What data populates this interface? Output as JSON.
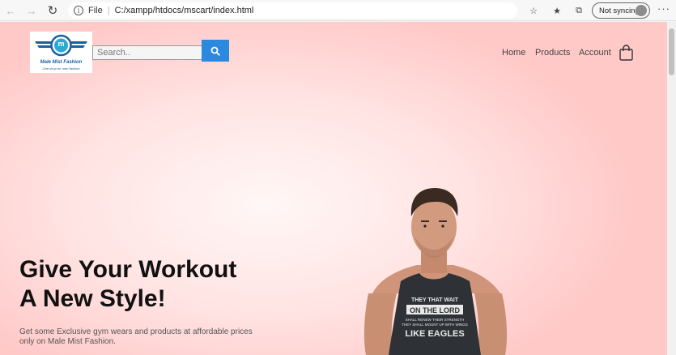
{
  "browser": {
    "file_label": "File",
    "url": "C:/xampp/htdocs/mscart/index.html",
    "sync_label": "Not syncing"
  },
  "site": {
    "brand": "Male Mist Fashion",
    "tagline": "One shop for men fashion",
    "logo_letter": "m",
    "search_placeholder": "Search..",
    "nav": [
      "Home",
      "Products",
      "Account"
    ],
    "hero": {
      "title_line1": "Give Your Workout",
      "title_line2": "A New Style!",
      "subtitle": "Get some Exclusive gym wears and products at affordable prices only on Male Mist Fashion.",
      "shirt_text": [
        "THEY THAT WAIT",
        "ON THE LORD",
        "SHALL RENEW THEIR STRENGTH",
        "THEY SHALL MOUNT UP WITH WINGS",
        "LIKE EAGLES"
      ]
    }
  },
  "colors": {
    "accent": "#2b8ae0",
    "bg": "#ffd6d5",
    "logo": "#1a5fa0"
  }
}
